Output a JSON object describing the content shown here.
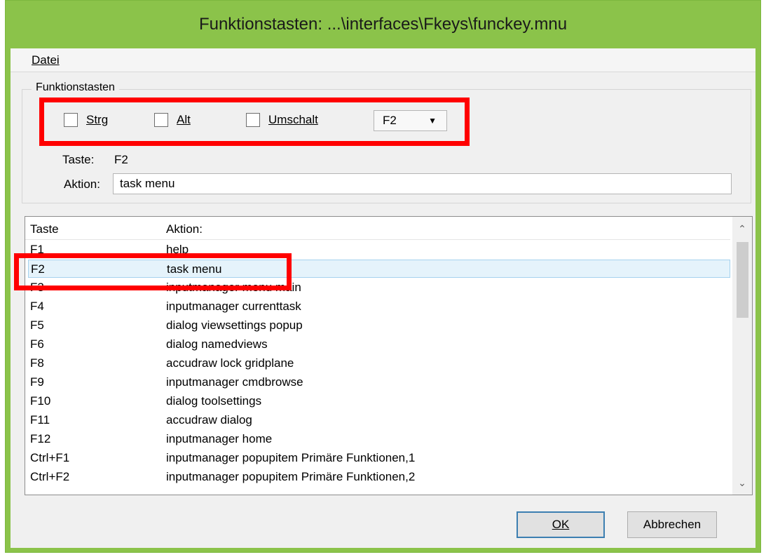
{
  "window": {
    "title": "Funktionstasten: ...\\interfaces\\Fkeys\\funckey.mnu"
  },
  "menu": {
    "items": [
      "Datei"
    ]
  },
  "group": {
    "legend": "Funktionstasten",
    "checkboxes": [
      {
        "label": "Strg",
        "checked": false
      },
      {
        "label": "Alt",
        "checked": false
      },
      {
        "label": "Umschalt",
        "checked": false
      }
    ],
    "key_select": {
      "value": "F2"
    },
    "taste_label": "Taste:",
    "taste_value": "F2",
    "aktion_label": "Aktion:",
    "aktion_value": "task menu"
  },
  "list": {
    "headers": {
      "key": "Taste",
      "action": "Aktion:"
    },
    "rows": [
      {
        "key": "F1",
        "action": "help"
      },
      {
        "key": "F2",
        "action": "task menu",
        "selected": true
      },
      {
        "key": "F3",
        "action": "inputmanager menu main"
      },
      {
        "key": "F4",
        "action": "inputmanager currenttask"
      },
      {
        "key": "F5",
        "action": "dialog viewsettings popup"
      },
      {
        "key": "F6",
        "action": "dialog namedviews"
      },
      {
        "key": "F8",
        "action": "accudraw lock gridplane"
      },
      {
        "key": "F9",
        "action": "inputmanager cmdbrowse"
      },
      {
        "key": "F10",
        "action": "dialog toolsettings"
      },
      {
        "key": "F11",
        "action": "accudraw dialog"
      },
      {
        "key": "F12",
        "action": "inputmanager home"
      },
      {
        "key": "Ctrl+F1",
        "action": "inputmanager popupitem Primäre Funktionen,1"
      },
      {
        "key": "Ctrl+F2",
        "action": "inputmanager popupitem Primäre Funktionen,2"
      }
    ]
  },
  "buttons": {
    "ok": "OK",
    "cancel": "Abbrechen"
  },
  "colors": {
    "titlebar": "#8bc34a",
    "highlight": "#ff0000",
    "selection": "#e5f3fb"
  },
  "icons": {
    "select_arrow": "▼",
    "scroll_up": "⌃",
    "scroll_down": "⌄"
  }
}
